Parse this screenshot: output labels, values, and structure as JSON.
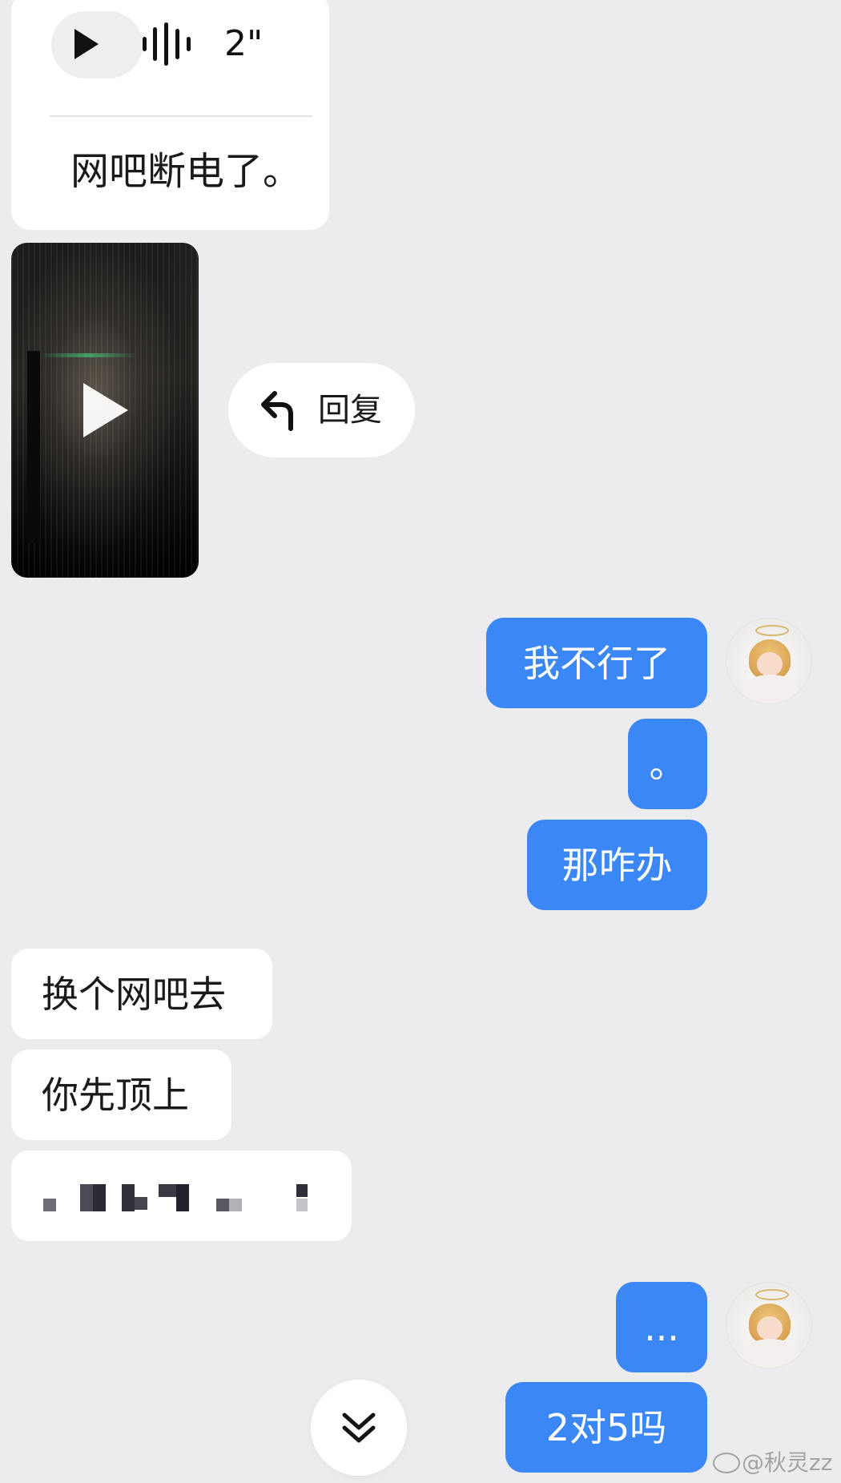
{
  "voice_message": {
    "duration": "2\"",
    "transcript": "网吧断电了。"
  },
  "video_message": {
    "play_icon": "play-icon"
  },
  "reply_action": {
    "label": "回复",
    "icon": "reply-arrow-icon"
  },
  "messages": [
    {
      "side": "sent",
      "text": "我不行了"
    },
    {
      "side": "sent",
      "text": "。"
    },
    {
      "side": "sent",
      "text": "那咋办"
    },
    {
      "side": "received",
      "text": "换个网吧去"
    },
    {
      "side": "received",
      "text": "你先顶上"
    },
    {
      "side": "received",
      "text": "",
      "note_visual": "pixelated"
    },
    {
      "side": "sent",
      "text": "..."
    },
    {
      "side": "sent",
      "text": "2对5吗"
    }
  ],
  "scroll_button": {
    "icon": "double-chevron-down-icon"
  },
  "watermark": {
    "text": "@秋灵zz"
  },
  "colors": {
    "background": "#ececee",
    "sent_bubble": "#3b87f6",
    "received_bubble": "#ffffff"
  }
}
